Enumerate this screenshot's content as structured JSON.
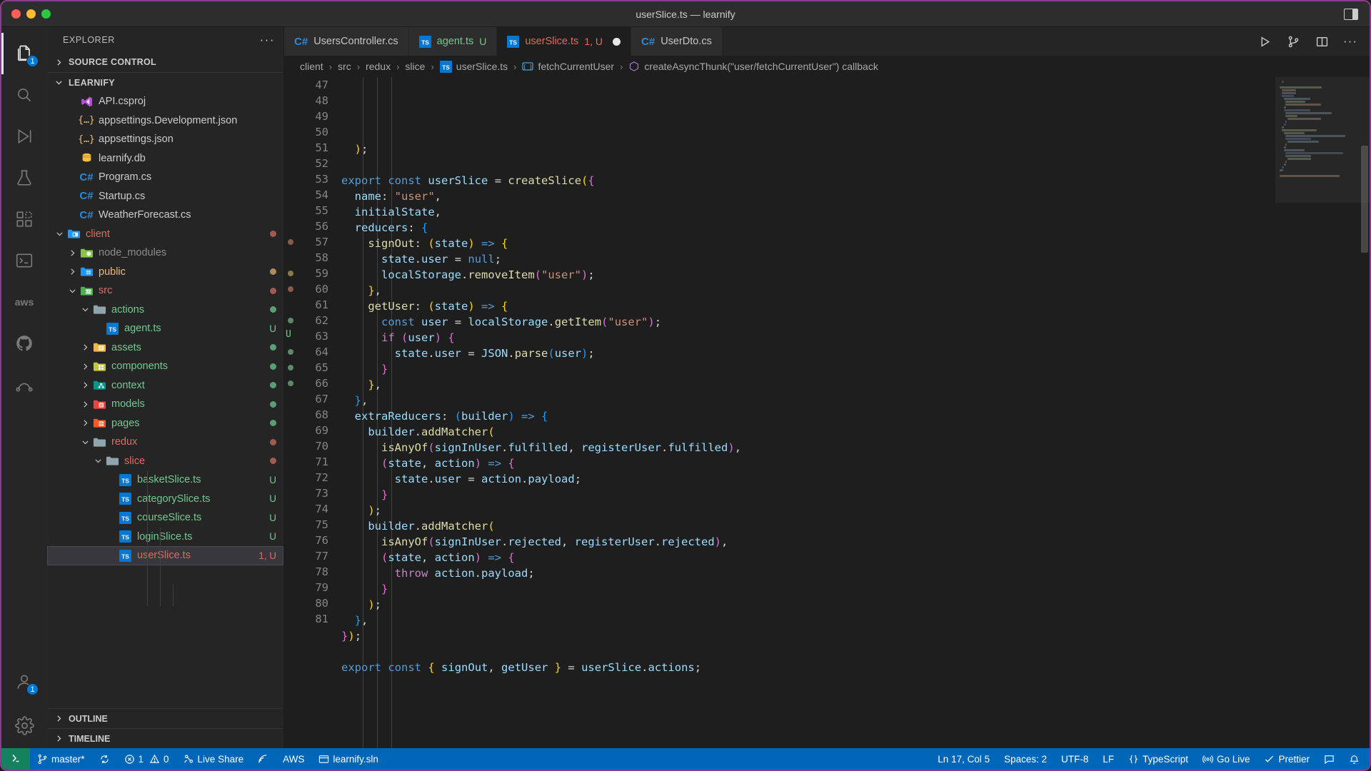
{
  "window": {
    "title": "userSlice.ts — learnify",
    "traffic_lights": [
      "close",
      "minimize",
      "maximize"
    ],
    "layout_toggle_icon": "panel-layout-icon"
  },
  "activitybar": {
    "items": [
      {
        "name": "explorer",
        "icon": "files-icon",
        "active": true,
        "badge": "1"
      },
      {
        "name": "search",
        "icon": "search-icon",
        "active": false,
        "badge": ""
      },
      {
        "name": "run-and-debug",
        "icon": "debug-icon",
        "active": false,
        "badge": ""
      },
      {
        "name": "testing",
        "icon": "beaker-icon",
        "active": false,
        "badge": ""
      },
      {
        "name": "extensions",
        "icon": "extensions-icon",
        "active": false,
        "badge": ""
      },
      {
        "name": "terminal",
        "icon": "terminal-icon",
        "active": false,
        "badge": ""
      },
      {
        "name": "aws-toolkit",
        "icon": "aws-icon",
        "active": false,
        "badge": ""
      },
      {
        "name": "github",
        "icon": "github-icon",
        "active": false,
        "badge": ""
      },
      {
        "name": "github-actions",
        "icon": "github-actions-icon",
        "active": false,
        "badge": ""
      }
    ],
    "bottom_items": [
      {
        "name": "accounts",
        "icon": "account-icon",
        "badge": "1"
      },
      {
        "name": "manage-settings",
        "icon": "gear-icon",
        "badge": ""
      }
    ]
  },
  "sidebar": {
    "header": "EXPLORER",
    "more_actions": "···",
    "sections": [
      {
        "label": "SOURCE CONTROL",
        "expanded": false
      },
      {
        "label": "LEARNIFY",
        "expanded": true
      }
    ],
    "bottom_sections": [
      {
        "label": "OUTLINE",
        "expanded": false
      },
      {
        "label": "TIMELINE",
        "expanded": false
      }
    ],
    "tree": [
      {
        "label": "API.csproj",
        "depth": 2,
        "type": "file",
        "icon": "visualstudio-icon",
        "color": "#cccccc",
        "badge": "",
        "badge_color": "",
        "dot": "",
        "twist": ""
      },
      {
        "label": "appsettings.Development.json",
        "depth": 2,
        "type": "file",
        "icon": "json-icon",
        "color": "#cccccc",
        "badge": "",
        "badge_color": "",
        "dot": "",
        "twist": ""
      },
      {
        "label": "appsettings.json",
        "depth": 2,
        "type": "file",
        "icon": "json-icon",
        "color": "#cccccc",
        "badge": "",
        "badge_color": "",
        "dot": "",
        "twist": ""
      },
      {
        "label": "learnify.db",
        "depth": 2,
        "type": "file",
        "icon": "database-icon",
        "color": "#cccccc",
        "badge": "",
        "badge_color": "",
        "dot": "",
        "twist": ""
      },
      {
        "label": "Program.cs",
        "depth": 2,
        "type": "file",
        "icon": "csharp-icon",
        "color": "#cccccc",
        "badge": "",
        "badge_color": "",
        "dot": "",
        "twist": ""
      },
      {
        "label": "Startup.cs",
        "depth": 2,
        "type": "file",
        "icon": "csharp-icon",
        "color": "#cccccc",
        "badge": "",
        "badge_color": "",
        "dot": "",
        "twist": ""
      },
      {
        "label": "WeatherForecast.cs",
        "depth": 2,
        "type": "file",
        "icon": "csharp-icon",
        "color": "#cccccc",
        "badge": "",
        "badge_color": "",
        "dot": "",
        "twist": ""
      },
      {
        "label": "client",
        "depth": 1,
        "type": "folder",
        "icon": "folder-client-icon",
        "color": "#e06c5d",
        "badge": "",
        "badge_color": "",
        "dot": "#a05a4f",
        "twist": "down"
      },
      {
        "label": "node_modules",
        "depth": 2,
        "type": "folder",
        "icon": "folder-node-icon",
        "color": "#8c8c8c",
        "badge": "",
        "badge_color": "",
        "dot": "",
        "twist": "right"
      },
      {
        "label": "public",
        "depth": 2,
        "type": "folder",
        "icon": "folder-public-icon",
        "color": "#e8c07d",
        "badge": "",
        "badge_color": "",
        "dot": "#b08a5a",
        "twist": "right"
      },
      {
        "label": "src",
        "depth": 2,
        "type": "folder",
        "icon": "folder-src-icon",
        "color": "#e06c5d",
        "badge": "",
        "badge_color": "",
        "dot": "#a05a4f",
        "twist": "down"
      },
      {
        "label": "actions",
        "depth": 3,
        "type": "folder",
        "icon": "folder-icon",
        "color": "#73c991",
        "badge": "",
        "badge_color": "",
        "dot": "#5a9e73",
        "twist": "down"
      },
      {
        "label": "agent.ts",
        "depth": 4,
        "type": "file",
        "icon": "typescript-icon",
        "color": "#73c991",
        "badge": "U",
        "badge_color": "#73c991",
        "dot": "",
        "twist": ""
      },
      {
        "label": "assets",
        "depth": 3,
        "type": "folder",
        "icon": "folder-assets-icon",
        "color": "#73c991",
        "badge": "",
        "badge_color": "",
        "dot": "#5a9e73",
        "twist": "right"
      },
      {
        "label": "components",
        "depth": 3,
        "type": "folder",
        "icon": "folder-comp-icon",
        "color": "#73c991",
        "badge": "",
        "badge_color": "",
        "dot": "#5a9e73",
        "twist": "right"
      },
      {
        "label": "context",
        "depth": 3,
        "type": "folder",
        "icon": "folder-ctx-icon",
        "color": "#73c991",
        "badge": "",
        "badge_color": "",
        "dot": "#5a9e73",
        "twist": "right"
      },
      {
        "label": "models",
        "depth": 3,
        "type": "folder",
        "icon": "folder-models-icon",
        "color": "#73c991",
        "badge": "",
        "badge_color": "",
        "dot": "#5a9e73",
        "twist": "right"
      },
      {
        "label": "pages",
        "depth": 3,
        "type": "folder",
        "icon": "folder-pages-icon",
        "color": "#73c991",
        "badge": "",
        "badge_color": "",
        "dot": "#5a9e73",
        "twist": "right"
      },
      {
        "label": "redux",
        "depth": 3,
        "type": "folder",
        "icon": "folder-icon",
        "color": "#e06c5d",
        "badge": "",
        "badge_color": "",
        "dot": "#a05a4f",
        "twist": "down"
      },
      {
        "label": "slice",
        "depth": 4,
        "type": "folder",
        "icon": "folder-icon",
        "color": "#e06c5d",
        "badge": "",
        "badge_color": "",
        "dot": "#a05a4f",
        "twist": "down"
      },
      {
        "label": "basketSlice.ts",
        "depth": 5,
        "type": "file",
        "icon": "typescript-icon",
        "color": "#73c991",
        "badge": "U",
        "badge_color": "#73c991",
        "dot": "",
        "twist": ""
      },
      {
        "label": "categorySlice.ts",
        "depth": 5,
        "type": "file",
        "icon": "typescript-icon",
        "color": "#73c991",
        "badge": "U",
        "badge_color": "#73c991",
        "dot": "",
        "twist": ""
      },
      {
        "label": "courseSlice.ts",
        "depth": 5,
        "type": "file",
        "icon": "typescript-icon",
        "color": "#73c991",
        "badge": "U",
        "badge_color": "#73c991",
        "dot": "",
        "twist": ""
      },
      {
        "label": "loginSlice.ts",
        "depth": 5,
        "type": "file",
        "icon": "typescript-icon",
        "color": "#73c991",
        "badge": "U",
        "badge_color": "#73c991",
        "dot": "",
        "twist": ""
      },
      {
        "label": "userSlice.ts",
        "depth": 5,
        "type": "file",
        "icon": "typescript-icon",
        "color": "#e06c5d",
        "badge": "1, U",
        "badge_color": "#e06c5d",
        "dot": "",
        "twist": "",
        "selected": true
      }
    ]
  },
  "tabs": [
    {
      "label": "UsersController.cs",
      "icon": "csharp-icon",
      "color": "#c5c5c5",
      "badge": "",
      "badge_color": "",
      "active": false,
      "dirty": false
    },
    {
      "label": "agent.ts",
      "icon": "typescript-icon",
      "color": "#73c991",
      "badge": "U",
      "badge_color": "#73c991",
      "active": false,
      "dirty": false
    },
    {
      "label": "userSlice.ts",
      "icon": "typescript-icon",
      "color": "#e06c5d",
      "badge": "1, U",
      "badge_color": "#e06c5d",
      "active": true,
      "dirty": true
    },
    {
      "label": "UserDto.cs",
      "icon": "csharp-icon",
      "color": "#c5c5c5",
      "badge": "",
      "badge_color": "",
      "active": false,
      "dirty": false
    }
  ],
  "tab_actions": [
    {
      "name": "run-file-button",
      "icon": "play-icon"
    },
    {
      "name": "source-control-button",
      "icon": "branch-icon"
    },
    {
      "name": "split-editor-button",
      "icon": "split-icon"
    },
    {
      "name": "more-actions-button",
      "icon": "ellipsis-icon"
    }
  ],
  "breadcrumbs": [
    {
      "label": "client",
      "icon": ""
    },
    {
      "label": "src",
      "icon": ""
    },
    {
      "label": "redux",
      "icon": ""
    },
    {
      "label": "slice",
      "icon": ""
    },
    {
      "label": "userSlice.ts",
      "icon": "typescript-icon"
    },
    {
      "label": "fetchCurrentUser",
      "icon": "variable-icon"
    },
    {
      "label": "createAsyncThunk(\"user/fetchCurrentUser\") callback",
      "icon": "symbol-icon"
    }
  ],
  "code": {
    "first_line": 47,
    "lines": [
      {
        "n": 47,
        "html": "  <span class='b1'>)</span>;"
      },
      {
        "n": 48,
        "html": ""
      },
      {
        "n": 49,
        "html": "<span class='k'>export</span> <span class='k'>const</span> <span class='v'>userSlice</span> <span class='p'>=</span> <span class='f'>createSlice</span><span class='b1'>(</span><span class='b2'>{</span>"
      },
      {
        "n": 50,
        "html": "  <span class='v'>name</span>: <span class='s'>\"user\"</span>,"
      },
      {
        "n": 51,
        "html": "  <span class='v'>initialState</span>,"
      },
      {
        "n": 52,
        "html": "  <span class='v'>reducers</span>: <span class='b3'>{</span>"
      },
      {
        "n": 53,
        "html": "    <span class='f'>signOut</span>: <span class='b1'>(</span><span class='v'>state</span><span class='b1'>)</span> <span class='ar'>=&gt;</span> <span class='b1'>{</span>"
      },
      {
        "n": 54,
        "html": "      <span class='v'>state</span>.<span class='v'>user</span> <span class='p'>=</span> <span class='k'>null</span>;"
      },
      {
        "n": 55,
        "html": "      <span class='v'>localStorage</span>.<span class='f'>removeItem</span><span class='b2'>(</span><span class='s'>\"user\"</span><span class='b2'>)</span>;"
      },
      {
        "n": 56,
        "html": "    <span class='b1'>}</span>,"
      },
      {
        "n": 57,
        "html": "    <span class='f'>getUser</span>: <span class='b1'>(</span><span class='v'>state</span><span class='b1'>)</span> <span class='ar'>=&gt;</span> <span class='b1'>{</span>"
      },
      {
        "n": 58,
        "html": "      <span class='k'>const</span> <span class='v'>user</span> <span class='p'>=</span> <span class='v'>localStorage</span>.<span class='f'>getItem</span><span class='b2'>(</span><span class='s'>\"user\"</span><span class='b2'>)</span>;"
      },
      {
        "n": 59,
        "html": "      <span class='kp'>if</span> <span class='b2'>(</span><span class='v'>user</span><span class='b2'>)</span> <span class='b2'>{</span>"
      },
      {
        "n": 60,
        "html": "        <span class='v'>state</span>.<span class='v'>user</span> <span class='p'>=</span> <span class='v'>JSON</span>.<span class='f'>parse</span><span class='b3'>(</span><span class='v'>user</span><span class='b3'>)</span>;"
      },
      {
        "n": 61,
        "html": "      <span class='b2'>}</span>"
      },
      {
        "n": 62,
        "html": "    <span class='b1'>}</span>,"
      },
      {
        "n": 63,
        "html": "  <span class='b3'>}</span>,"
      },
      {
        "n": 64,
        "html": "  <span class='v'>extraReducers</span>: <span class='b3'>(</span><span class='v'>builder</span><span class='b3'>)</span> <span class='ar'>=&gt;</span> <span class='b3'>{</span>"
      },
      {
        "n": 65,
        "html": "    <span class='v'>builder</span>.<span class='f'>addMatcher</span><span class='b1'>(</span>"
      },
      {
        "n": 66,
        "html": "      <span class='f'>isAnyOf</span><span class='b2'>(</span><span class='v'>signInUser</span>.<span class='v'>fulfilled</span>, <span class='v'>registerUser</span>.<span class='v'>fulfilled</span><span class='b2'>)</span>,"
      },
      {
        "n": 67,
        "html": "      <span class='b2'>(</span><span class='v'>state</span>, <span class='v'>action</span><span class='b2'>)</span> <span class='ar'>=&gt;</span> <span class='b2'>{</span>"
      },
      {
        "n": 68,
        "html": "        <span class='v'>state</span>.<span class='v'>user</span> <span class='p'>=</span> <span class='v'>action</span>.<span class='v'>payload</span>;"
      },
      {
        "n": 69,
        "html": "      <span class='b2'>}</span>"
      },
      {
        "n": 70,
        "html": "    <span class='b1'>)</span>;"
      },
      {
        "n": 71,
        "html": "    <span class='v'>builder</span>.<span class='f'>addMatcher</span><span class='b1'>(</span>"
      },
      {
        "n": 72,
        "html": "      <span class='f'>isAnyOf</span><span class='b2'>(</span><span class='v'>signInUser</span>.<span class='v'>rejected</span>, <span class='v'>registerUser</span>.<span class='v'>rejected</span><span class='b2'>)</span>,"
      },
      {
        "n": 73,
        "html": "      <span class='b2'>(</span><span class='v'>state</span>, <span class='v'>action</span><span class='b2'>)</span> <span class='ar'>=&gt;</span> <span class='b2'>{</span>"
      },
      {
        "n": 74,
        "html": "        <span class='kp'>throw</span> <span class='v'>action</span>.<span class='v'>payload</span>;"
      },
      {
        "n": 75,
        "html": "      <span class='b2'>}</span>"
      },
      {
        "n": 76,
        "html": "    <span class='b1'>)</span>;"
      },
      {
        "n": 77,
        "html": "  <span class='b3'>}</span>,"
      },
      {
        "n": 78,
        "html": "<span class='b2'>}</span><span class='b1'>)</span>;"
      },
      {
        "n": 79,
        "html": ""
      },
      {
        "n": 80,
        "html": "<span class='k'>export</span> <span class='k'>const</span> <span class='b1'>{</span> <span class='v'>signOut</span>, <span class='v'>getUser</span> <span class='b1'>}</span> <span class='p'>=</span> <span class='v'>userSlice</span>.<span class='v'>actions</span>;"
      },
      {
        "n": 81,
        "html": ""
      }
    ],
    "gutter_marks": [
      {
        "line": 57,
        "color": "#8a5a4a"
      },
      {
        "line": 59,
        "color": "#8a7a4a"
      },
      {
        "line": 60,
        "color": "#8a5a4a"
      },
      {
        "line": 62,
        "color": "#5a8a6a"
      },
      {
        "line": 63,
        "color": "#73c991",
        "text": "U"
      },
      {
        "line": 64,
        "color": "#5a8a6a"
      },
      {
        "line": 65,
        "color": "#5a8a6a"
      },
      {
        "line": 66,
        "color": "#5a8a6a"
      }
    ]
  },
  "statusbar": {
    "remote_icon": "remote-window-icon",
    "left": [
      {
        "name": "branch",
        "icon": "branch-icon",
        "label": "master*"
      },
      {
        "name": "sync",
        "icon": "sync-icon",
        "label": ""
      },
      {
        "name": "problems",
        "icon": "error-icon",
        "label": "1",
        "icon2": "warning-icon",
        "label2": "0"
      },
      {
        "name": "live-share",
        "icon": "live-share-icon",
        "label": "Live Share"
      },
      {
        "name": "sonarlint",
        "icon": "sonarlint-icon",
        "label": ""
      },
      {
        "name": "aws",
        "icon": "",
        "label": "AWS"
      },
      {
        "name": "solution",
        "icon": "window-icon",
        "label": "learnify.sln"
      }
    ],
    "right": [
      {
        "name": "cursor-position",
        "icon": "",
        "label": "Ln 17, Col 5"
      },
      {
        "name": "indentation",
        "icon": "",
        "label": "Spaces: 2"
      },
      {
        "name": "encoding",
        "icon": "",
        "label": "UTF-8"
      },
      {
        "name": "eol",
        "icon": "",
        "label": "LF"
      },
      {
        "name": "language-mode",
        "icon": "braces-icon",
        "label": "TypeScript"
      },
      {
        "name": "go-live",
        "icon": "broadcast-icon",
        "label": "Go Live"
      },
      {
        "name": "prettier",
        "icon": "check-icon",
        "label": "Prettier"
      },
      {
        "name": "editor-actions",
        "icon": "feedback-icon",
        "label": ""
      },
      {
        "name": "notifications",
        "icon": "bell-icon",
        "label": ""
      }
    ]
  },
  "colors": {
    "accent": "#0067b8",
    "remote_green": "#16825d",
    "editor_bg": "#1e1e1e",
    "sidebar_bg": "#252526",
    "selection": "#37373d",
    "window_border": "#8b3d8b"
  }
}
